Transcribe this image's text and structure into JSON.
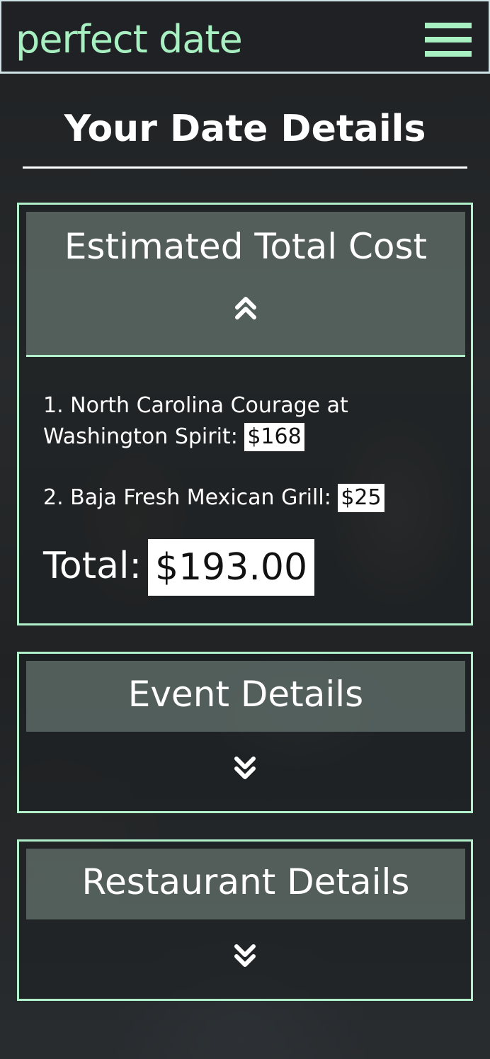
{
  "header": {
    "brand": "perfect date",
    "menu_icon": "hamburger-menu-icon"
  },
  "page": {
    "title": "Your Date Details"
  },
  "cost_section": {
    "title": "Estimated Total Cost",
    "toggle_icon": "chevron-double-up-icon",
    "items": [
      {
        "line1": "1. North Carolina Courage at",
        "line2": "Washington Spirit",
        "sep": ": ",
        "price": "$168"
      },
      {
        "line1": "2. Baja Fresh Mexican Grill",
        "sep": ": ",
        "price": "$25"
      }
    ],
    "total_label": "Total:",
    "total_value": "$193.00"
  },
  "event_section": {
    "title": "Event Details",
    "toggle_icon": "chevron-double-down-icon"
  },
  "restaurant_section": {
    "title": "Restaurant Details",
    "toggle_icon": "chevron-double-down-icon"
  },
  "colors": {
    "accent": "#a8f0c2",
    "border": "#b2f0cc",
    "background": "#1f2124"
  }
}
